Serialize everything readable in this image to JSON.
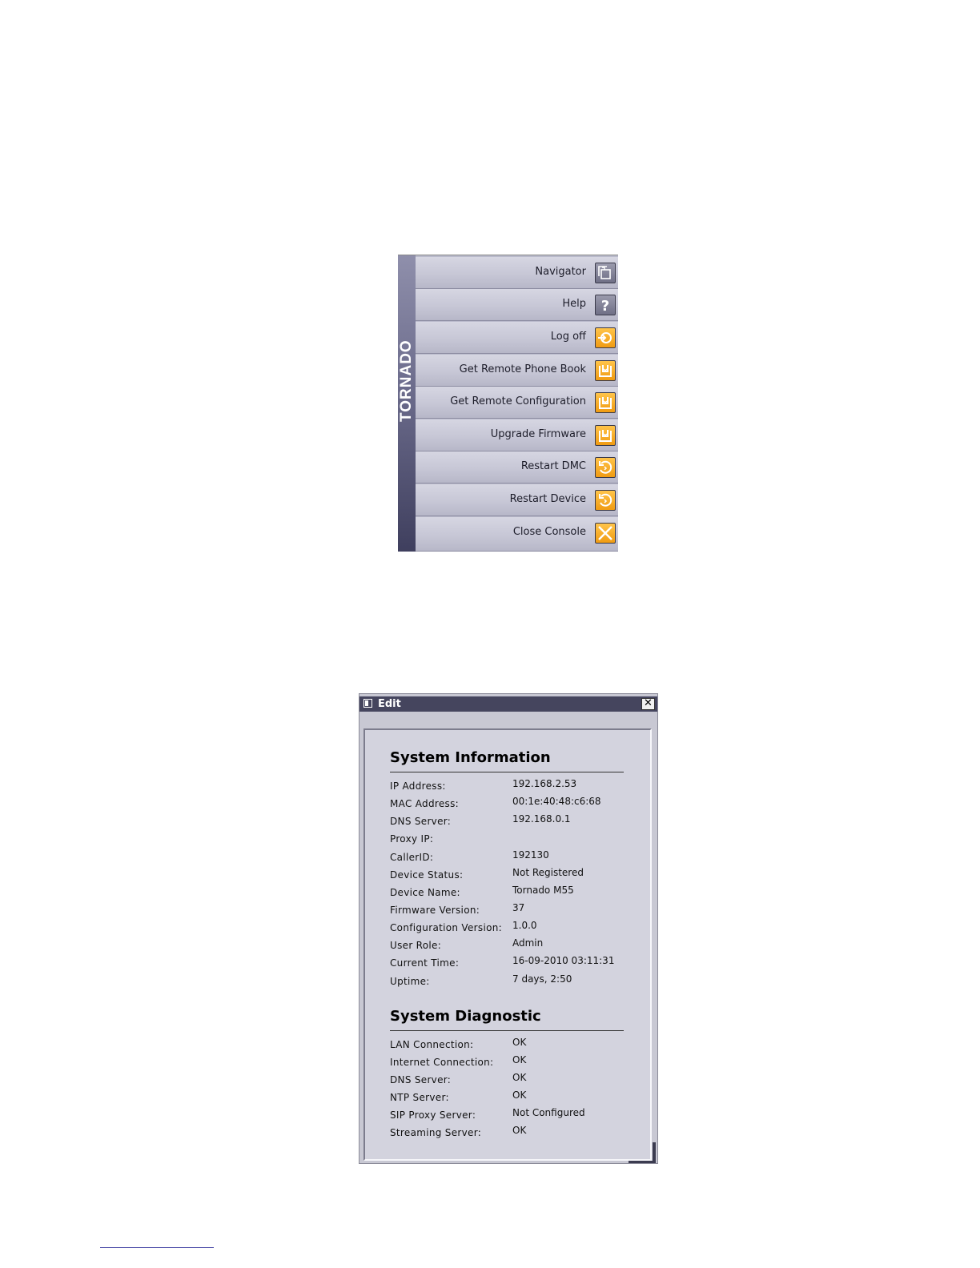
{
  "menu": {
    "brand": "TORNADO",
    "items": [
      {
        "label": "Navigator",
        "icon": "navigator-icon",
        "style": "gray"
      },
      {
        "label": "Help",
        "icon": "help-icon",
        "style": "gray"
      },
      {
        "label": "Log off",
        "icon": "log-off-icon",
        "style": "orange"
      },
      {
        "label": "Get Remote Phone Book",
        "icon": "download-icon",
        "style": "orange"
      },
      {
        "label": "Get Remote Configuration",
        "icon": "download-icon",
        "style": "orange"
      },
      {
        "label": "Upgrade Firmware",
        "icon": "download-icon",
        "style": "orange"
      },
      {
        "label": "Restart DMC",
        "icon": "restart-icon",
        "style": "orange"
      },
      {
        "label": "Restart Device",
        "icon": "restart-icon",
        "style": "orange"
      },
      {
        "label": "Close Console",
        "icon": "close-icon",
        "style": "orange"
      }
    ]
  },
  "dialog": {
    "title": "Edit",
    "close_glyph": "✕",
    "system_information": {
      "heading": "System Information",
      "rows": [
        {
          "key": "IP Address:",
          "value": "192.168.2.53"
        },
        {
          "key": "MAC Address:",
          "value": "00:1e:40:48:c6:68"
        },
        {
          "key": "DNS Server:",
          "value": "192.168.0.1"
        },
        {
          "key": "Proxy IP:",
          "value": ""
        },
        {
          "key": "CallerID:",
          "value": "192130"
        },
        {
          "key": "Device Status:",
          "value": "Not Registered"
        },
        {
          "key": "Device Name:",
          "value": "Tornado M55"
        },
        {
          "key": "Firmware Version:",
          "value": "37"
        },
        {
          "key": "Configuration Version:",
          "value": "1.0.0"
        },
        {
          "key": "User Role:",
          "value": "Admin"
        },
        {
          "key": "Current Time:",
          "value": "16-09-2010 03:11:31"
        },
        {
          "key": "Uptime:",
          "value": "7 days, 2:50"
        }
      ]
    },
    "system_diagnostic": {
      "heading": "System Diagnostic",
      "rows": [
        {
          "key": "LAN Connection:",
          "value": "OK"
        },
        {
          "key": "Internet Connection:",
          "value": "OK"
        },
        {
          "key": "DNS Server:",
          "value": "OK"
        },
        {
          "key": "NTP Server:",
          "value": "OK"
        },
        {
          "key": "SIP Proxy Server:",
          "value": "Not Configured"
        },
        {
          "key": "Streaming Server:",
          "value": "OK"
        }
      ]
    }
  },
  "colors": {
    "menu_bg": "#c7c7d6",
    "brand_strip": "#6c6c8c",
    "icon_orange": "#f5a623",
    "icon_gray": "#7c7c92",
    "dialog_titlebar": "#45455e",
    "dialog_bg": "#d3d3de"
  }
}
